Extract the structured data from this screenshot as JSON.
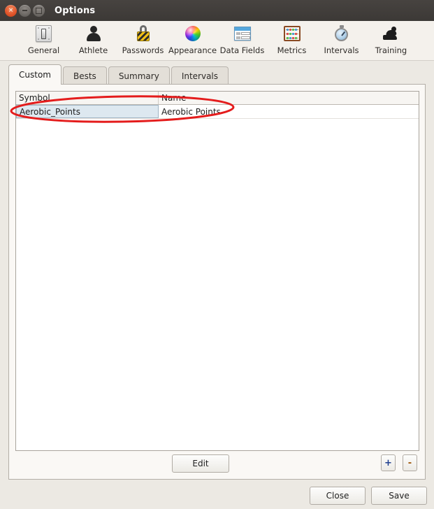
{
  "window": {
    "title": "Options",
    "controls": [
      {
        "name": "close",
        "glyph": "×"
      },
      {
        "name": "minimize",
        "glyph": ""
      },
      {
        "name": "maximize",
        "glyph": ""
      }
    ]
  },
  "toolbar": {
    "items": [
      {
        "label": "General",
        "icon": "light-switch-icon"
      },
      {
        "label": "Athlete",
        "icon": "person-icon"
      },
      {
        "label": "Passwords",
        "icon": "padlock-icon"
      },
      {
        "label": "Appearance",
        "icon": "color-wheel-icon"
      },
      {
        "label": "Data Fields",
        "icon": "form-window-icon"
      },
      {
        "label": "Metrics",
        "icon": "abacus-icon"
      },
      {
        "label": "Intervals",
        "icon": "stopwatch-icon"
      },
      {
        "label": "Training",
        "icon": "exercise-person-icon"
      }
    ]
  },
  "tabs": [
    {
      "label": "Custom",
      "active": true
    },
    {
      "label": "Bests",
      "active": false
    },
    {
      "label": "Summary",
      "active": false
    },
    {
      "label": "Intervals",
      "active": false
    }
  ],
  "table": {
    "columns": [
      "Symbol",
      "Name"
    ],
    "rows": [
      {
        "symbol": "Aerobic_Points",
        "name": "Aerobic Points",
        "selected": true
      }
    ]
  },
  "panel_buttons": {
    "edit_label": "Edit",
    "add_label": "+",
    "remove_label": "-"
  },
  "footer": {
    "close_label": "Close",
    "save_label": "Save"
  },
  "annotation": {
    "shape": "ellipse",
    "color": "#e41c1c"
  },
  "colors": {
    "titlebar": "#3f3c39",
    "toolbar": "#f4f1ec",
    "window_bg": "#ece9e3",
    "panel": "#faf8f5",
    "list_bg": "#ffffff",
    "row_selected": "#dde8f0",
    "annotation_red": "#e41c1c"
  }
}
